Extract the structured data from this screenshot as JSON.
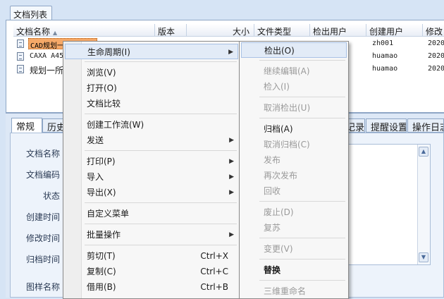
{
  "top_tab": {
    "label": "文档列表"
  },
  "table": {
    "headers": [
      "文档名称",
      "版本",
      "大小",
      "文件类型",
      "检出用户",
      "创建用户",
      "修改"
    ],
    "rows": [
      {
        "name": "CAD规划一",
        "creator": "zh001",
        "modified": "2020"
      },
      {
        "name": "CAXA A45",
        "creator": "huamao",
        "modified": "2020"
      },
      {
        "name": "规划一所",
        "creator": "huamao",
        "modified": "2020"
      }
    ]
  },
  "detail_tabs": {
    "left": [
      "常规",
      "历史"
    ],
    "right": [
      "记录",
      "提醒设置",
      "操作日志"
    ]
  },
  "form": {
    "labels": [
      "文档名称",
      "文档编码",
      "状态",
      "创建时间",
      "修改时间",
      "归档时间",
      "图样名称"
    ]
  },
  "context_menu": {
    "items": [
      {
        "label": "生命周期(I)",
        "submenu": true,
        "highlighted": true
      },
      {
        "sep": true
      },
      {
        "label": "浏览(V)"
      },
      {
        "label": "打开(O)"
      },
      {
        "label": "文档比较"
      },
      {
        "sep": true
      },
      {
        "label": "创建工作流(W)"
      },
      {
        "label": "发送",
        "submenu": true
      },
      {
        "sep": true
      },
      {
        "label": "打印(P)",
        "submenu": true
      },
      {
        "label": "导入",
        "submenu": true
      },
      {
        "label": "导出(X)",
        "submenu": true
      },
      {
        "sep": true
      },
      {
        "label": "自定义菜单"
      },
      {
        "sep": true
      },
      {
        "label": "批量操作",
        "submenu": true
      },
      {
        "sep": true
      },
      {
        "label": "剪切(T)",
        "shortcut": "Ctrl+X"
      },
      {
        "label": "复制(C)",
        "shortcut": "Ctrl+C"
      },
      {
        "label": "借用(B)",
        "shortcut": "Ctrl+B"
      }
    ]
  },
  "lifecycle_submenu": {
    "items": [
      {
        "label": "检出(O)",
        "highlighted": true
      },
      {
        "sep": true
      },
      {
        "label": "继续编辑(A)",
        "disabled": true
      },
      {
        "label": "检入(I)",
        "disabled": true
      },
      {
        "sep": true
      },
      {
        "label": "取消检出(U)",
        "disabled": true
      },
      {
        "sep": true
      },
      {
        "label": "归档(A)"
      },
      {
        "label": "取消归档(C)",
        "disabled": true
      },
      {
        "label": "发布",
        "disabled": true
      },
      {
        "label": "再次发布",
        "disabled": true
      },
      {
        "label": "回收",
        "disabled": true
      },
      {
        "sep": true
      },
      {
        "label": "废止(D)",
        "disabled": true
      },
      {
        "label": "复苏",
        "disabled": true
      },
      {
        "sep": true
      },
      {
        "label": "变更(V)",
        "disabled": true
      },
      {
        "sep": true
      },
      {
        "label": "替换",
        "bold": true
      },
      {
        "sep": true
      },
      {
        "label": "三维重命名",
        "disabled": true
      }
    ]
  }
}
